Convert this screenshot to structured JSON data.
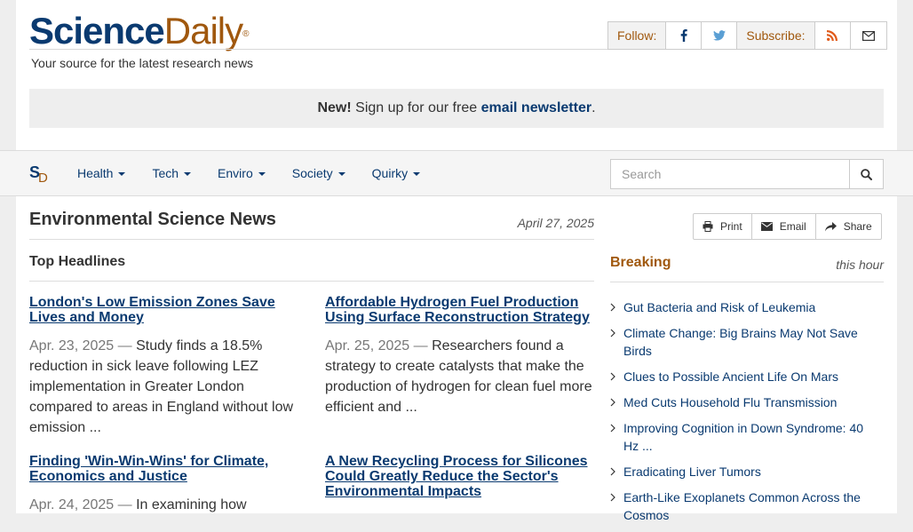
{
  "header": {
    "logo_science": "Science",
    "logo_daily": "Daily",
    "logo_reg": "®",
    "tagline": "Your source for the latest research news",
    "follow_label": "Follow:",
    "subscribe_label": "Subscribe:"
  },
  "newsletter": {
    "new_label": "New!",
    "text": " Sign up for our free ",
    "link": "email newsletter",
    "end": "."
  },
  "nav": {
    "logo_s": "S",
    "logo_d": "D",
    "items": [
      {
        "label": "Health"
      },
      {
        "label": "Tech"
      },
      {
        "label": "Enviro"
      },
      {
        "label": "Society"
      },
      {
        "label": "Quirky"
      }
    ],
    "search_placeholder": "Search"
  },
  "main": {
    "title": "Environmental Science News",
    "date": "April 27, 2025",
    "section": "Top Headlines",
    "articles": [
      {
        "title": "London's Low Emission Zones Save Lives and Money",
        "date": "Apr. 23, 2025",
        "summary": "Study finds a 18.5% reduction in sick leave following LEZ implementation in Greater London compared to areas in England without low emission ..."
      },
      {
        "title": "Affordable Hydrogen Fuel Production Using Surface Reconstruction Strategy",
        "date": "Apr. 25, 2025",
        "summary": "Researchers found a strategy to create catalysts that make the production of hydrogen for clean fuel more efficient and ..."
      },
      {
        "title": "Finding 'Win-Win-Wins' for Climate, Economics and Justice",
        "date": "Apr. 24, 2025",
        "summary": "In examining how"
      },
      {
        "title": "A New Recycling Process for Silicones Could Greatly Reduce the Sector's Environmental Impacts",
        "date": "",
        "summary": ""
      }
    ],
    "dash": "—"
  },
  "sidebar": {
    "print": "Print",
    "email": "Email",
    "share": "Share",
    "breaking": "Breaking",
    "this_hour": "this hour",
    "items": [
      {
        "label": "Gut Bacteria and Risk of Leukemia"
      },
      {
        "label": "Climate Change: Big Brains May Not Save Birds"
      },
      {
        "label": "Clues to Possible Ancient Life On Mars"
      },
      {
        "label": "Med Cuts Household Flu Transmission"
      },
      {
        "label": "Improving Cognition in Down Syndrome: 40 Hz ..."
      },
      {
        "label": "Eradicating Liver Tumors"
      },
      {
        "label": "Earth-Like Exoplanets Common Across the Cosmos"
      }
    ]
  },
  "colors": {
    "brand_blue": "#0a3a70",
    "brand_orange": "#a0580e"
  }
}
